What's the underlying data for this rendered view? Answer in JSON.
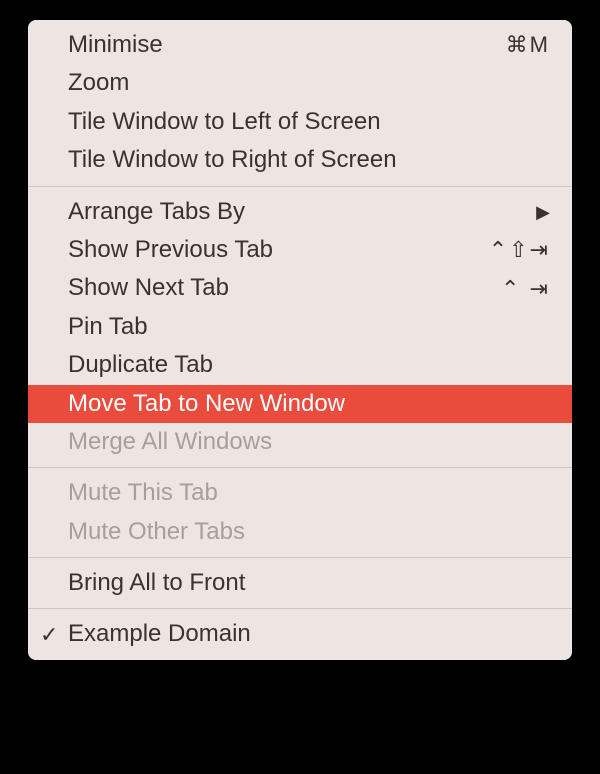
{
  "menu": {
    "groups": [
      {
        "items": [
          {
            "label": "Minimise",
            "shortcut": "⌘M",
            "disabled": false,
            "highlighted": false,
            "hasSubmenu": false,
            "checked": false
          },
          {
            "label": "Zoom",
            "shortcut": "",
            "disabled": false,
            "highlighted": false,
            "hasSubmenu": false,
            "checked": false
          },
          {
            "label": "Tile Window to Left of Screen",
            "shortcut": "",
            "disabled": false,
            "highlighted": false,
            "hasSubmenu": false,
            "checked": false
          },
          {
            "label": "Tile Window to Right of Screen",
            "shortcut": "",
            "disabled": false,
            "highlighted": false,
            "hasSubmenu": false,
            "checked": false
          }
        ]
      },
      {
        "items": [
          {
            "label": "Arrange Tabs By",
            "shortcut": "",
            "disabled": false,
            "highlighted": false,
            "hasSubmenu": true,
            "checked": false
          },
          {
            "label": "Show Previous Tab",
            "shortcut": "⌃⇧⇥",
            "disabled": false,
            "highlighted": false,
            "hasSubmenu": false,
            "checked": false
          },
          {
            "label": "Show Next Tab",
            "shortcut": "⌃  ⇥",
            "disabled": false,
            "highlighted": false,
            "hasSubmenu": false,
            "checked": false
          },
          {
            "label": "Pin Tab",
            "shortcut": "",
            "disabled": false,
            "highlighted": false,
            "hasSubmenu": false,
            "checked": false
          },
          {
            "label": "Duplicate Tab",
            "shortcut": "",
            "disabled": false,
            "highlighted": false,
            "hasSubmenu": false,
            "checked": false
          },
          {
            "label": "Move Tab to New Window",
            "shortcut": "",
            "disabled": false,
            "highlighted": true,
            "hasSubmenu": false,
            "checked": false
          },
          {
            "label": "Merge All Windows",
            "shortcut": "",
            "disabled": true,
            "highlighted": false,
            "hasSubmenu": false,
            "checked": false
          }
        ]
      },
      {
        "items": [
          {
            "label": "Mute This Tab",
            "shortcut": "",
            "disabled": true,
            "highlighted": false,
            "hasSubmenu": false,
            "checked": false
          },
          {
            "label": "Mute Other Tabs",
            "shortcut": "",
            "disabled": true,
            "highlighted": false,
            "hasSubmenu": false,
            "checked": false
          }
        ]
      },
      {
        "items": [
          {
            "label": "Bring All to Front",
            "shortcut": "",
            "disabled": false,
            "highlighted": false,
            "hasSubmenu": false,
            "checked": false
          }
        ]
      },
      {
        "items": [
          {
            "label": "Example Domain",
            "shortcut": "",
            "disabled": false,
            "highlighted": false,
            "hasSubmenu": false,
            "checked": true
          }
        ]
      }
    ]
  },
  "symbols": {
    "checkmark": "✓",
    "submenuArrow": "▶"
  }
}
